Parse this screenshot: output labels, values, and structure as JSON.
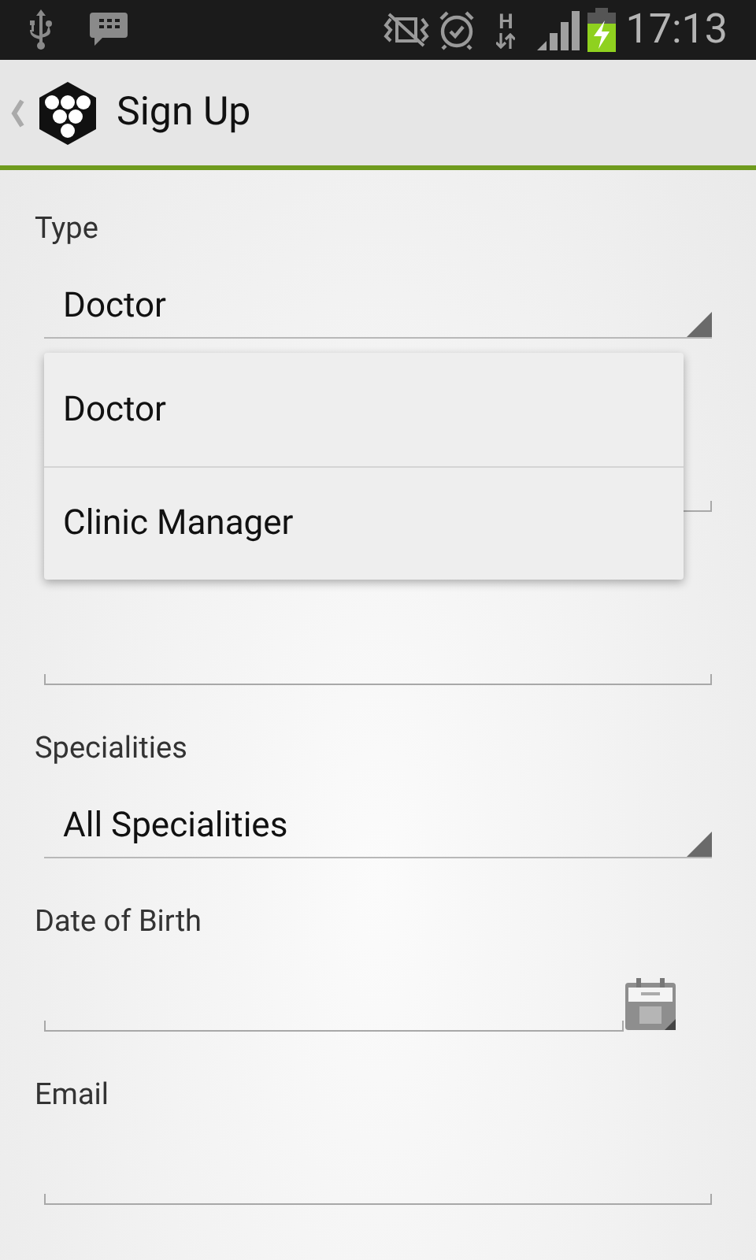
{
  "status_bar": {
    "network_type": "H",
    "time": "17:13",
    "charging": true
  },
  "action_bar": {
    "title": "Sign Up"
  },
  "fields": [
    {
      "kind": "spinner",
      "label": "Type",
      "value": "Doctor"
    },
    {
      "kind": "text"
    },
    {
      "kind": "text"
    },
    {
      "kind": "spinner",
      "label": "Specialities",
      "value": "All Specialities"
    },
    {
      "kind": "date",
      "label": "Date of Birth"
    },
    {
      "kind": "text",
      "label": "Email"
    }
  ],
  "dropdown": {
    "options": [
      {
        "label": "Doctor"
      },
      {
        "label": "Clinic Manager"
      }
    ]
  }
}
